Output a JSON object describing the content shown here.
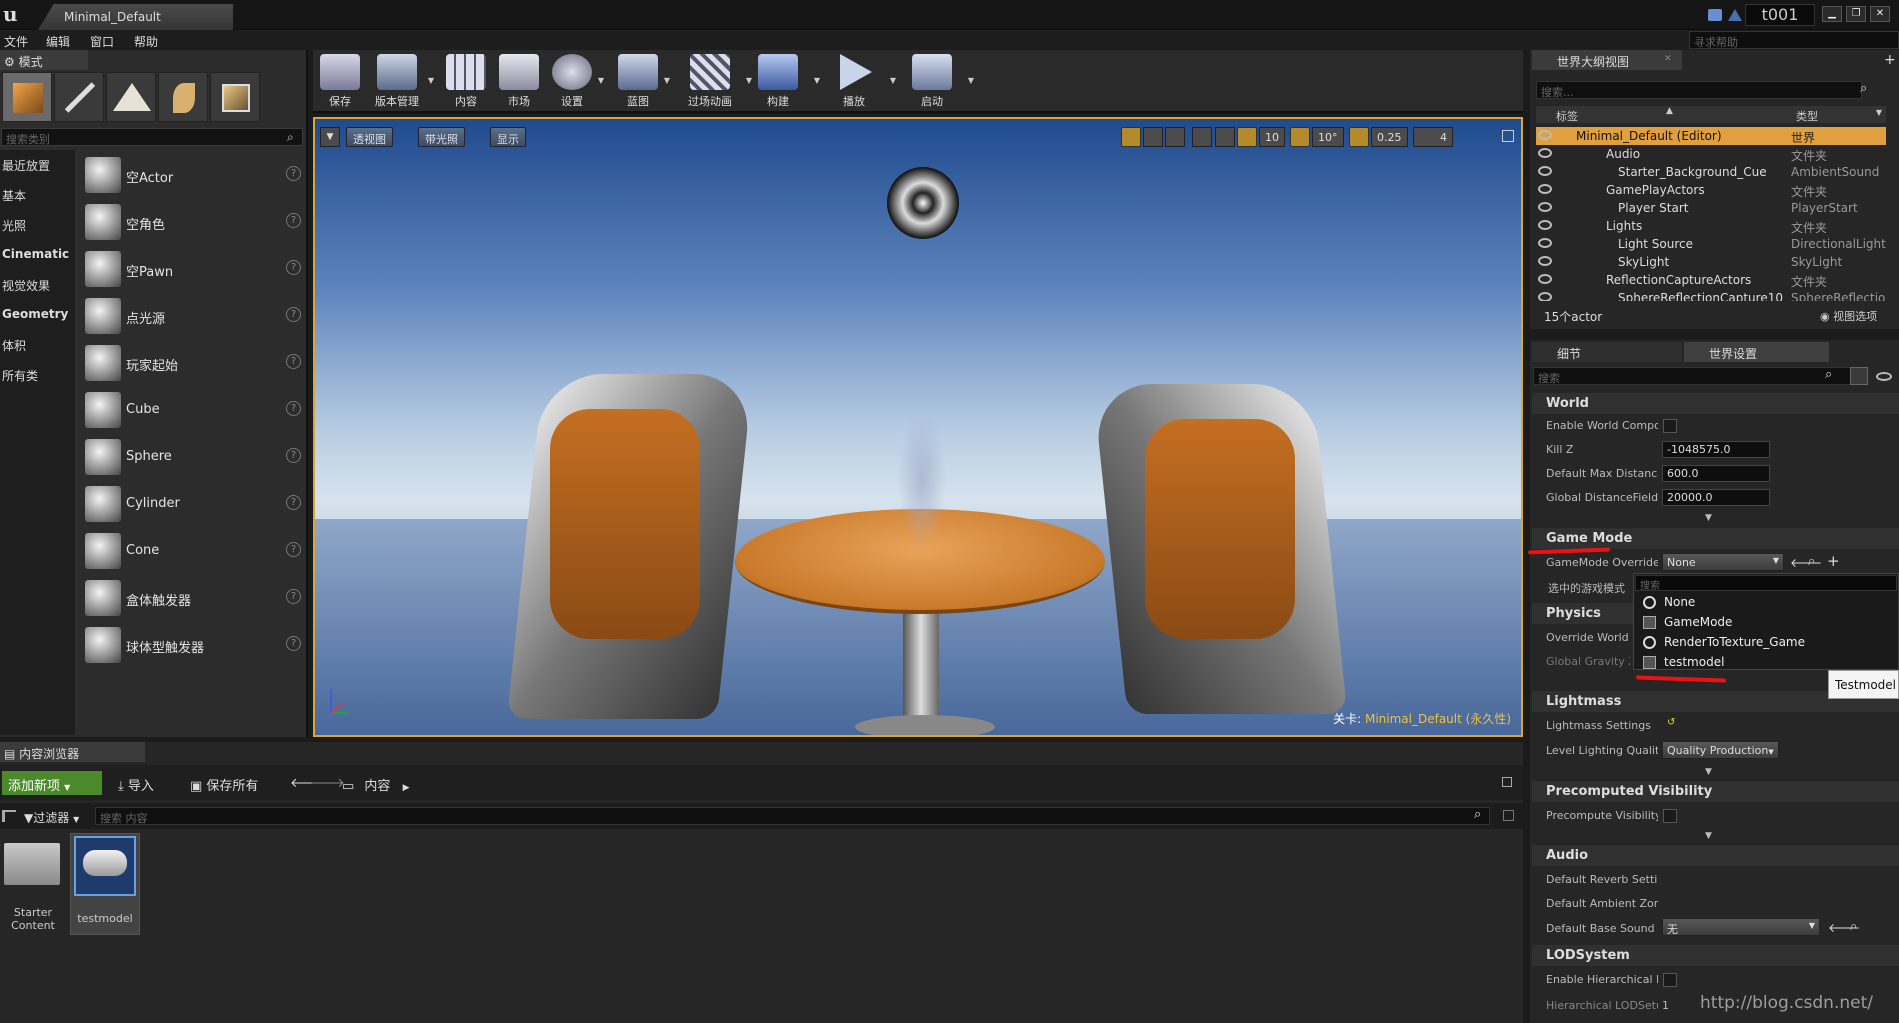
{
  "titlebar": {
    "doc_tab": "Minimal_Default",
    "project": "t001"
  },
  "menu": {
    "items": [
      "文件",
      "编辑",
      "窗口",
      "帮助"
    ],
    "help_search_placeholder": "寻求帮助"
  },
  "modes": {
    "tab": "模式",
    "search_placeholder": "搜索类别",
    "categories": [
      "最近放置",
      "基本",
      "光照",
      "Cinematic",
      "视觉效果",
      "Geometry",
      "体积",
      "所有类"
    ],
    "items": [
      "空Actor",
      "空角色",
      "空Pawn",
      "点光源",
      "玩家起始",
      "Cube",
      "Sphere",
      "Cylinder",
      "Cone",
      "盒体触发器",
      "球体型触发器"
    ],
    "help_glyph": "?"
  },
  "toolbar": {
    "buttons": [
      "保存",
      "版本管理",
      "内容",
      "市场",
      "设置",
      "蓝图",
      "过场动画",
      "构建",
      "播放",
      "启动"
    ]
  },
  "viewport": {
    "buttons": [
      "透视图",
      "带光照",
      "显示"
    ],
    "snap_grid": "10",
    "snap_rot": "10°",
    "snap_scale": "0.25",
    "cam_speed": "4",
    "level_prefix": "关卡:",
    "level_name": "Minimal_Default (永久性)"
  },
  "content_browser": {
    "tab": "内容浏览器",
    "add_new": "添加新项",
    "import": "导入",
    "save_all": "保存所有",
    "path": "内容",
    "filters": "过滤器",
    "search_placeholder": "搜索 内容",
    "assets": [
      {
        "label_1": "Starter",
        "label_2": "Content"
      },
      {
        "label": "testmodel"
      }
    ]
  },
  "outliner": {
    "tab": "世界大纲视图",
    "search_placeholder": "搜索...",
    "col_label": "标签",
    "col_type": "类型",
    "rows": [
      {
        "name": "Minimal_Default (Editor)",
        "type": "世界"
      },
      {
        "name": "Audio",
        "type": "文件夹"
      },
      {
        "name": "Starter_Background_Cue",
        "type": "AmbientSound"
      },
      {
        "name": "GamePlayActors",
        "type": "文件夹"
      },
      {
        "name": "Player Start",
        "type": "PlayerStart"
      },
      {
        "name": "Lights",
        "type": "文件夹"
      },
      {
        "name": "Light Source",
        "type": "DirectionalLight"
      },
      {
        "name": "SkyLight",
        "type": "SkyLight"
      },
      {
        "name": "ReflectionCaptureActors",
        "type": "文件夹"
      },
      {
        "name": "SphereReflectionCapture10",
        "type": "SphereReflectionC"
      }
    ],
    "count": "15个actor",
    "view_options": "视图选项"
  },
  "details": {
    "tabs": [
      "细节",
      "世界设置"
    ],
    "search_placeholder": "搜索",
    "world": {
      "title": "World",
      "enable_world_compos": "Enable World Compos",
      "kill_z": "Kill Z",
      "kill_z_val": "-1048575.0",
      "max_dist": "Default Max Distance",
      "max_dist_val": "600.0",
      "gdf": "Global DistanceField V",
      "gdf_val": "20000.0"
    },
    "game_mode": {
      "title": "Game Mode",
      "override": "GameMode Override",
      "override_val": "None",
      "selected": "选中的游戏模式"
    },
    "physics": {
      "title": "Physics",
      "override_world": "Override World G",
      "global_gravity": "Global Gravity Z"
    },
    "lightmass": {
      "title": "Lightmass",
      "settings": "Lightmass Settings",
      "quality": "Level Lighting Quality",
      "quality_val": "Quality Production"
    },
    "precomputed": {
      "title": "Precomputed Visibility",
      "pv": "Precompute Visibility"
    },
    "audio": {
      "title": "Audio",
      "reverb": "Default Reverb Settin",
      "ambient": "Default Ambient Zone",
      "base_sound": "Default Base Sound M",
      "base_sound_val": "无"
    },
    "lod": {
      "title": "LODSystem",
      "enable": "Enable Hierarchical LC",
      "setup": "Hierarchical LODSetu",
      "setup_val": "1"
    }
  },
  "dropdown": {
    "search_placeholder": "搜索",
    "items": [
      "None",
      "GameMode",
      "RenderToTexture_Game",
      "testmodel"
    ]
  },
  "tooltip": "Testmodel",
  "watermark": "http://blog.csdn.net/"
}
